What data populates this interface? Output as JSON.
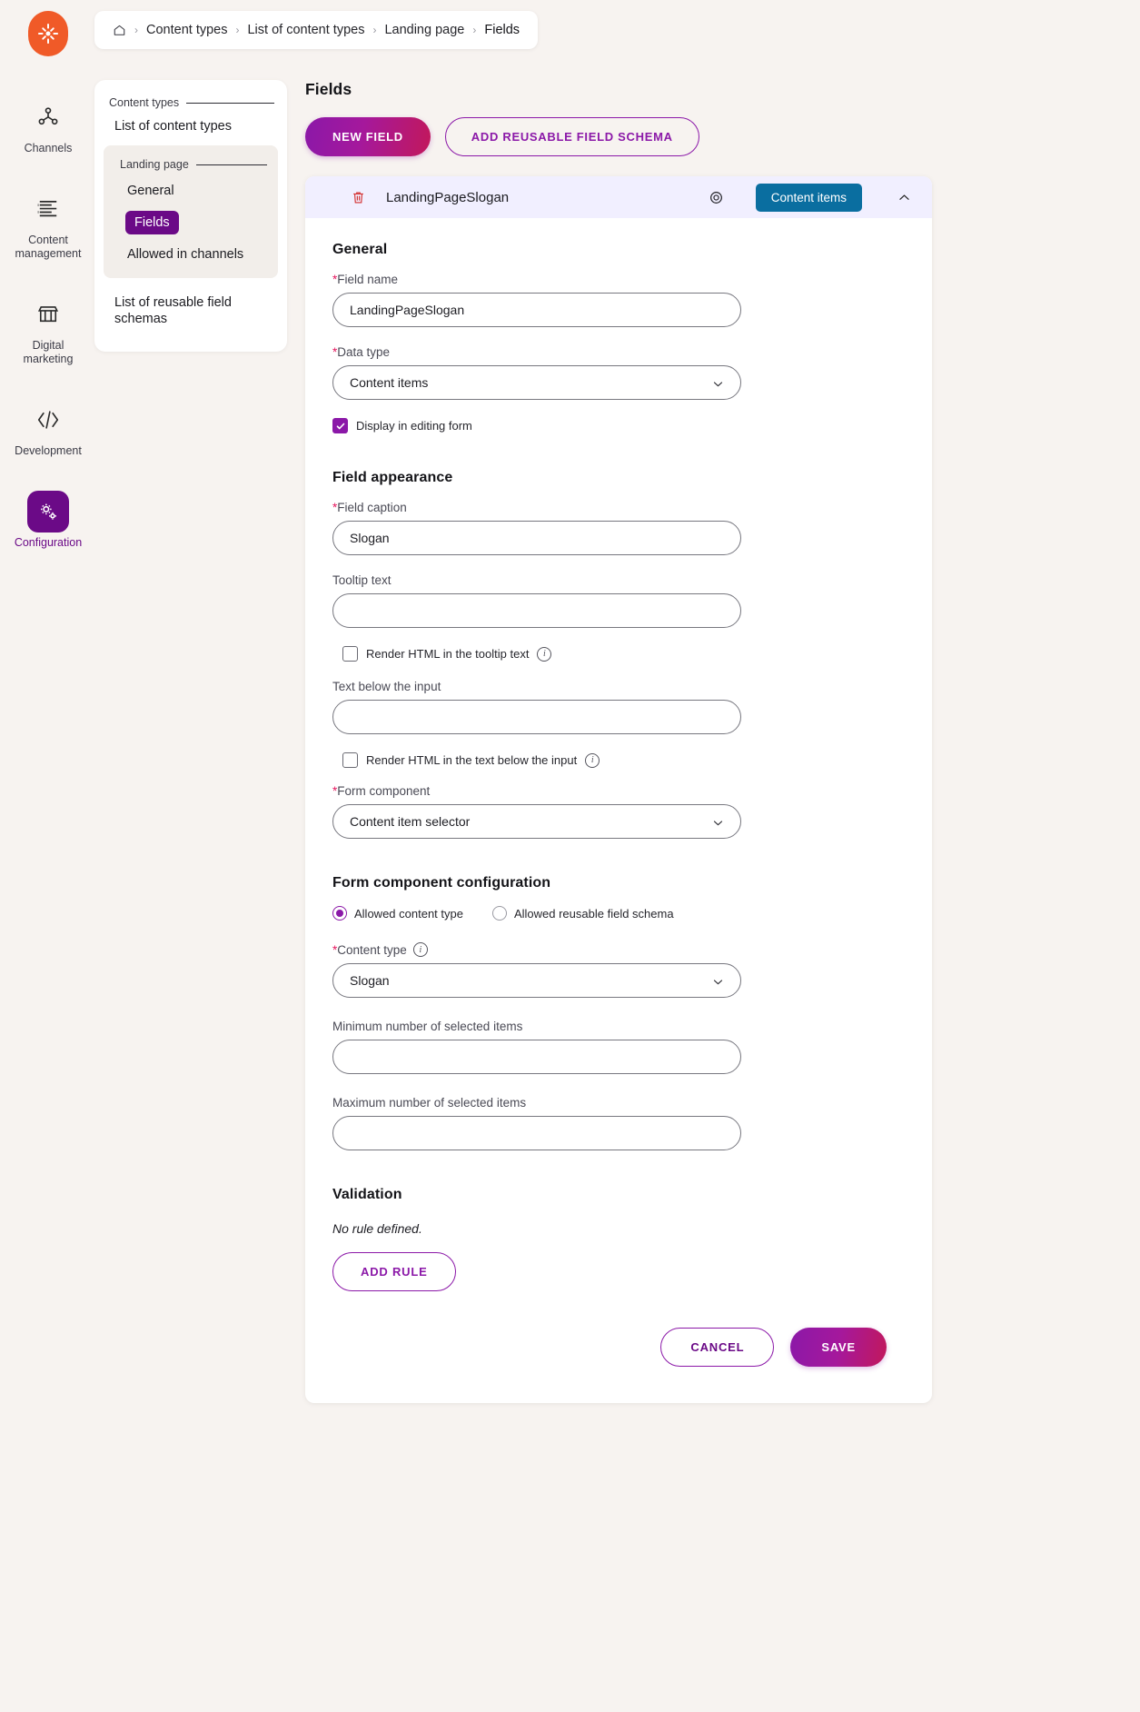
{
  "colors": {
    "brand_orange": "#f05a28",
    "accent_purple": "#8b18a8",
    "active_purple": "#6b0a87",
    "teal_pill": "#0a6ea0",
    "required_red": "#e5175e",
    "trash_red": "#d32f2f",
    "page_bg": "#f7f3f0",
    "card_head_bg": "#f1efff"
  },
  "rail": {
    "logo_name": "kentico-logo",
    "items": [
      {
        "icon": "channels-icon",
        "label": "Channels",
        "active": false
      },
      {
        "icon": "content-management-icon",
        "label": "Content management",
        "active": false
      },
      {
        "icon": "digital-marketing-icon",
        "label": "Digital marketing",
        "active": false
      },
      {
        "icon": "development-icon",
        "label": "Development",
        "active": false
      },
      {
        "icon": "configuration-icon",
        "label": "Configuration",
        "active": true
      }
    ]
  },
  "breadcrumb": {
    "home_icon": "home-icon",
    "items": [
      "Content types",
      "List of content types",
      "Landing page",
      "Fields"
    ],
    "separator": "›"
  },
  "subnav": {
    "header": "Content types",
    "link": "List of content types",
    "group": {
      "header": "Landing page",
      "items": [
        {
          "label": "General",
          "active": false
        },
        {
          "label": "Fields",
          "active": true
        },
        {
          "label": "Allowed in channels",
          "active": false
        }
      ]
    },
    "footer_link": "List of reusable field schemas"
  },
  "main": {
    "title": "Fields",
    "new_field_button": "NEW FIELD",
    "add_reusable_button": "ADD REUSABLE FIELD SCHEMA"
  },
  "field_card": {
    "trash_icon": "trash-icon",
    "name": "LandingPageSlogan",
    "eye_icon": "eye-icon",
    "pill_label": "Content items",
    "collapse_icon": "chevron-up-icon"
  },
  "general": {
    "section_title": "General",
    "field_name_label": "Field name",
    "field_name_value": "LandingPageSlogan",
    "field_name_placeholder": "",
    "data_type_label": "Data type",
    "data_type_value": "Content items",
    "display_checkbox_label": "Display in editing form",
    "display_checkbox_checked": true
  },
  "appearance": {
    "section_title": "Field appearance",
    "caption_label": "Field caption",
    "caption_value": "Slogan",
    "tooltip_label": "Tooltip text",
    "tooltip_value": "",
    "render_tooltip_label": "Render HTML in the tooltip text",
    "render_tooltip_checked": false,
    "below_label": "Text below the input",
    "below_value": "",
    "render_below_label": "Render HTML in the text below the input",
    "render_below_checked": false,
    "form_component_label": "Form component",
    "form_component_value": "Content item selector"
  },
  "form_config": {
    "section_title": "Form component configuration",
    "radio_options": [
      {
        "label": "Allowed content type",
        "selected": true
      },
      {
        "label": "Allowed reusable field schema",
        "selected": false
      }
    ],
    "content_type_label": "Content type",
    "content_type_value": "Slogan",
    "min_items_label": "Minimum number of selected items",
    "min_items_value": "",
    "max_items_label": "Maximum number of selected items",
    "max_items_value": ""
  },
  "validation": {
    "section_title": "Validation",
    "empty_text": "No rule defined.",
    "add_rule_button": "ADD RULE"
  },
  "footer": {
    "cancel_button": "CANCEL",
    "save_button": "SAVE"
  }
}
